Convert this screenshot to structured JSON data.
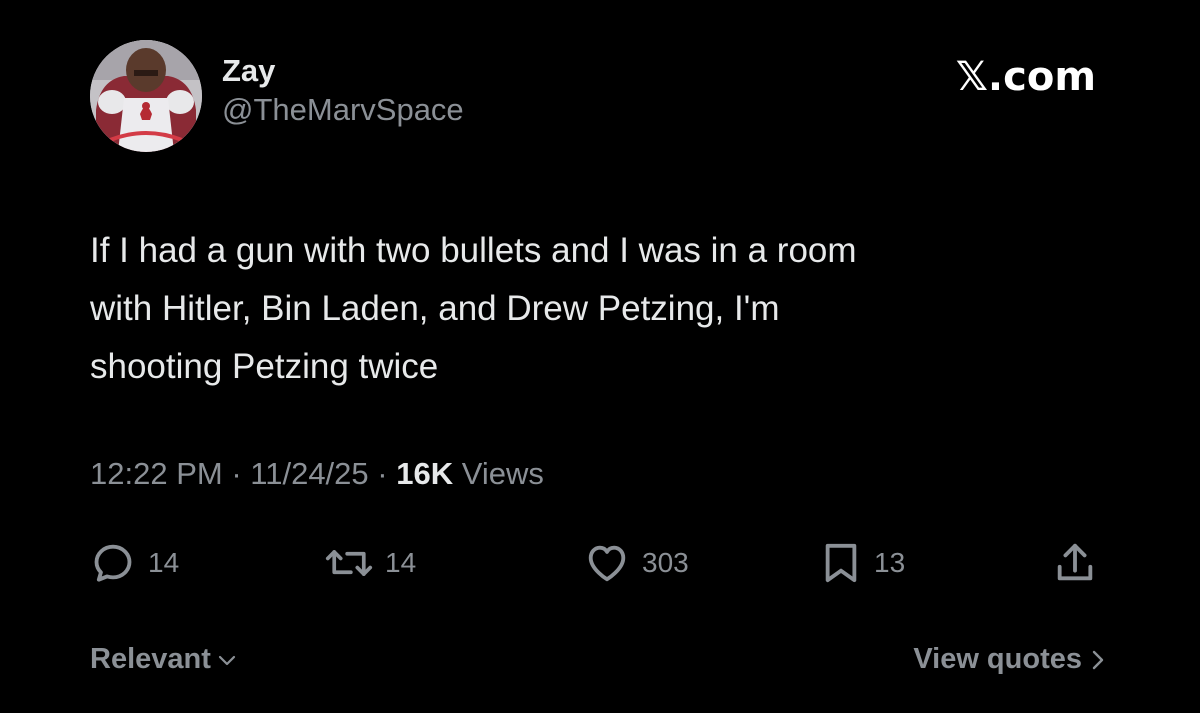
{
  "author": {
    "display_name": "Zay",
    "handle": "@TheMarvSpace",
    "avatar_icon": "user-avatar"
  },
  "brand": {
    "label": "𝕏.com"
  },
  "tweet": {
    "text_lines": [
      "If I had a gun with two bullets and I was in a room",
      "with Hitler, Bin Laden, and Drew Petzing, I'm",
      "shooting Petzing twice"
    ]
  },
  "meta": {
    "time": "12:22 PM",
    "separator": "·",
    "date": "11/24/25",
    "views_count": "16K",
    "views_label": "Views"
  },
  "actions": {
    "reply": {
      "icon": "reply-icon",
      "count": "14"
    },
    "retweet": {
      "icon": "retweet-icon",
      "count": "14"
    },
    "like": {
      "icon": "heart-icon",
      "count": "303"
    },
    "bookmark": {
      "icon": "bookmark-icon",
      "count": "13"
    },
    "share": {
      "icon": "share-icon"
    }
  },
  "footer": {
    "sort_label": "Relevant",
    "view_quotes_label": "View quotes"
  },
  "colors": {
    "background": "#000000",
    "primary_text": "#e7e9ea",
    "secondary_text": "#8b9096"
  }
}
